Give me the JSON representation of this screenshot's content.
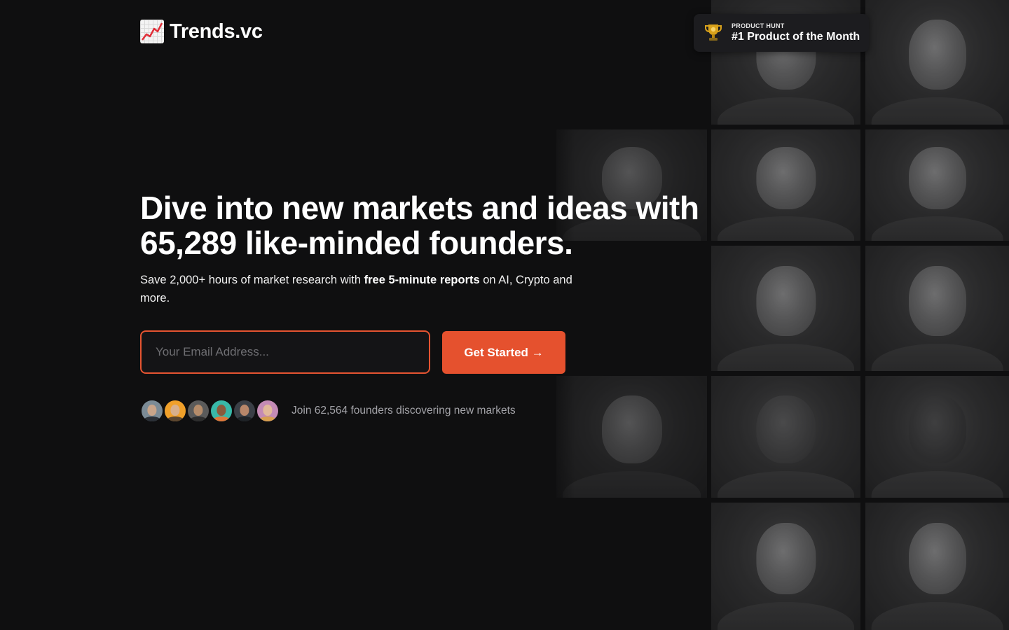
{
  "brand": {
    "name": "Trends.vc",
    "icon": "chart-increasing-icon"
  },
  "badge": {
    "kicker": "PRODUCT HUNT",
    "title": "#1 Product of the Month",
    "icon": "trophy-icon"
  },
  "hero": {
    "headline_line1": "Dive into new markets and ideas with",
    "headline_line2": "65,289 like-minded founders.",
    "sub_before": "Save 2,000+ hours of market research with ",
    "sub_bold": "free 5-minute reports",
    "sub_after": " on AI, Crypto and more."
  },
  "signup": {
    "email_placeholder": "Your Email Address...",
    "email_value": "",
    "cta_label": "Get Started →"
  },
  "social_proof": {
    "text": "Join 62,564 founders discovering new markets",
    "avatars": [
      {
        "bg": "#7b8b96",
        "skin": "#c9a58a",
        "body": "#2a2f36"
      },
      {
        "bg": "#f0a02a",
        "skin": "#d9b08c",
        "body": "#5b4630"
      },
      {
        "bg": "#5a5a5a",
        "skin": "#b58c6a",
        "body": "#2d2d2d"
      },
      {
        "bg": "#39b8a8",
        "skin": "#8a5a3c",
        "body": "#e0783a"
      },
      {
        "bg": "#3a3f46",
        "skin": "#b8876a",
        "body": "#1e2226"
      },
      {
        "bg": "#c48bb5",
        "skin": "#e2b99a",
        "body": "#d8a050"
      }
    ]
  },
  "colors": {
    "accent": "#e5512e",
    "background": "#0f0f10"
  }
}
